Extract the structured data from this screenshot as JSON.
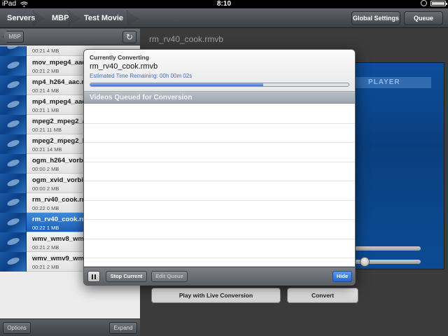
{
  "status_bar": {
    "device": "iPad",
    "time": "8:10"
  },
  "nav": {
    "breadcrumbs": [
      "Servers",
      "MBP",
      "Test Movie"
    ],
    "global_settings_label": "Global Settings",
    "queue_label": "Queue"
  },
  "left_panel": {
    "back_label": "MBP",
    "options_label": "Options",
    "expand_label": "Expand",
    "items": [
      {
        "name": "",
        "meta": "00:21  4 MB"
      },
      {
        "name": "mov_mpeg4_aac.m",
        "meta": "00:21  2 MB"
      },
      {
        "name": "mp4_h264_aac.ma",
        "meta": "00:21  4 MB"
      },
      {
        "name": "mp4_mpeg4_aac.",
        "meta": "00:21  1 MB"
      },
      {
        "name": "mpeg2_mpeg2_ac",
        "meta": "00:21  11 MB"
      },
      {
        "name": "mpeg2_mpeg2_lp",
        "meta": "00:21  14 MB"
      },
      {
        "name": "ogm_h264_vorbis",
        "meta": "00:00  2 MB"
      },
      {
        "name": "ogm_xvid_vorbis.",
        "meta": "00:00  2 MB"
      },
      {
        "name": "rm_rv40_cook.rm",
        "meta": "00:22  0 MB"
      },
      {
        "name": "rm_rv40_cook.rm",
        "meta": "00:22  1 MB"
      },
      {
        "name": "wmv_wmv8_wma.",
        "meta": "00:21  2 MB"
      },
      {
        "name": "wmv_wmv9_wma.asf",
        "meta": "00:21  2 MB"
      }
    ],
    "selected_index": 9
  },
  "detail": {
    "title": "rm_rv40_cook.rmvb",
    "preview_brand": "PLAYER",
    "play_live_label": "Play with Live Conversion",
    "convert_label": "Convert",
    "slider1_value": 0.0,
    "slider2_value": 0.1
  },
  "popover": {
    "currently_label": "Currently Converting",
    "file": "rm_rv40_cook.rmvb",
    "eta": "Estimated Time Remaining:  00h 00m 02s",
    "progress": 0.67,
    "queue_header": "Videos Queued for Conversion",
    "stop_label": "Stop Current",
    "edit_label": "Edit Queue",
    "hide_label": "Hide",
    "queue_rows": 8
  }
}
